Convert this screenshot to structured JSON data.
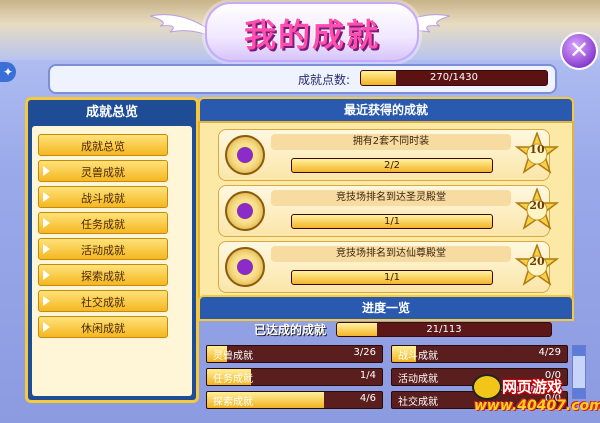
{
  "window": {
    "title": "我的成就",
    "close_icon": "close-icon"
  },
  "points": {
    "label": "成就点数:",
    "value_text": "270/1430",
    "fraction": 0.189
  },
  "sidebar": {
    "header": "成就总览",
    "items": [
      {
        "label": "成就总览",
        "has_arrow": false
      },
      {
        "label": "灵兽成就",
        "has_arrow": true
      },
      {
        "label": "战斗成就",
        "has_arrow": true
      },
      {
        "label": "任务成就",
        "has_arrow": true
      },
      {
        "label": "活动成就",
        "has_arrow": true
      },
      {
        "label": "探索成就",
        "has_arrow": true
      },
      {
        "label": "社交成就",
        "has_arrow": true
      },
      {
        "label": "休闲成就",
        "has_arrow": true
      }
    ]
  },
  "recent": {
    "header": "最近获得的成就",
    "items": [
      {
        "name": "拥有2套不同时装",
        "progress_text": "2/2",
        "fraction": 1.0,
        "points": "10"
      },
      {
        "name": "竞技场排名到达圣灵殿堂",
        "progress_text": "1/1",
        "fraction": 1.0,
        "points": "20"
      },
      {
        "name": "竞技场排名到达仙尊殿堂",
        "progress_text": "1/1",
        "fraction": 1.0,
        "points": "20"
      }
    ]
  },
  "progress": {
    "header": "进度一览",
    "done_label": "已达成的成就",
    "done_text": "21/113",
    "done_fraction": 0.186,
    "categories": [
      {
        "name": "灵兽成就",
        "count": "3/26",
        "fraction": 0.115
      },
      {
        "name": "战斗成就",
        "count": "4/29",
        "fraction": 0.138
      },
      {
        "name": "任务成就",
        "count": "1/4",
        "fraction": 0.25
      },
      {
        "name": "活动成就",
        "count": "0/0",
        "fraction": 0.0
      },
      {
        "name": "探索成就",
        "count": "4/6",
        "fraction": 0.667
      },
      {
        "name": "社交成就",
        "count": "0/0",
        "fraction": 0.0
      }
    ]
  },
  "watermark": {
    "main": "网页游戏",
    "url": "www.40407.com"
  },
  "colors": {
    "accent": "#f6c93a",
    "panel_blue": "#2a5ab0",
    "bar_fill": "#f2b322",
    "bar_track": "#5a1e1e"
  }
}
